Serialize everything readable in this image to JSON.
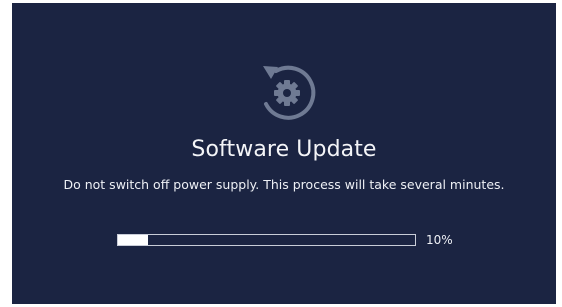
{
  "update_screen": {
    "title": "Software Update",
    "message": "Do not switch off power supply. This process will take several minutes.",
    "icon": "gear-refresh-icon",
    "progress": {
      "percent": 10,
      "label": "10%"
    }
  },
  "colors": {
    "background": "#1b2442",
    "icon": "#6f7a93",
    "text": "#f4f5f8",
    "progress_fill": "#ffffff",
    "progress_border": "#c9cdd8"
  }
}
